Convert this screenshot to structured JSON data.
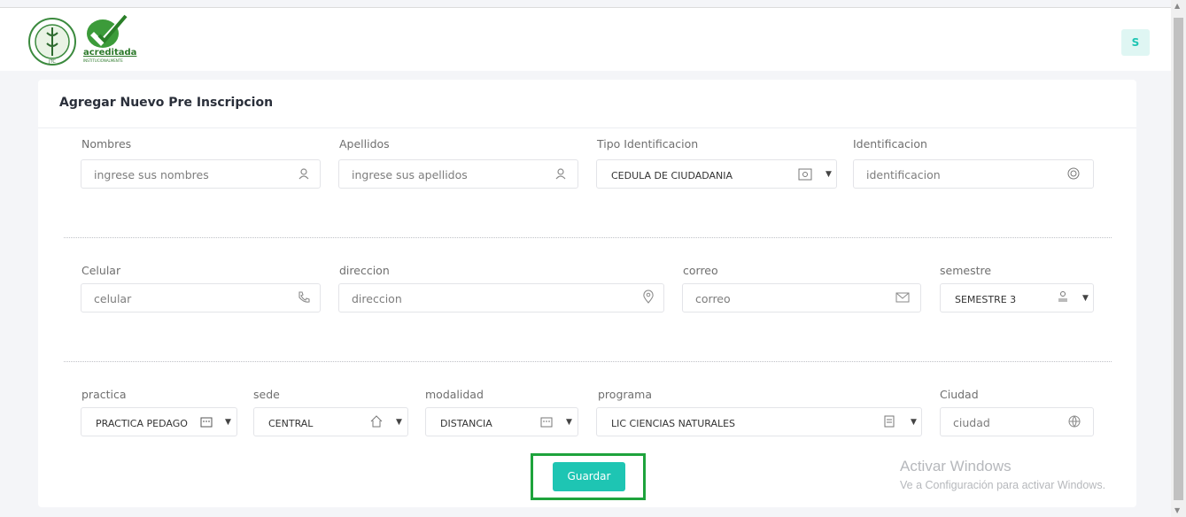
{
  "header": {
    "avatar_letter": "S",
    "logo_text": "acreditada",
    "logo_subtext": "INSTITUCIONALMENTE"
  },
  "form": {
    "title": "Agregar Nuevo Pre Inscripcion",
    "rows": [
      [
        {
          "label": "Nombres",
          "placeholder": "ingrese sus nombres",
          "icon": "user-icon"
        },
        {
          "label": "Apellidos",
          "placeholder": "ingrese sus apellidos",
          "icon": "user-icon"
        },
        {
          "label": "Tipo Identificacion",
          "value": "CEDULA DE CIUDADANIA",
          "icon": "id-card-icon"
        },
        {
          "label": "Identificacion",
          "placeholder": "identificacion",
          "icon": "fingerprint-icon"
        }
      ],
      [
        {
          "label": "Celular",
          "placeholder": "celular",
          "icon": "phone-icon"
        },
        {
          "label": "direccion",
          "placeholder": "direccion",
          "icon": "location-pin-icon"
        },
        {
          "label": "correo",
          "placeholder": "correo",
          "icon": "envelope-icon"
        },
        {
          "label": "semestre",
          "value": "SEMESTRE 3",
          "icon": "hierarchy-icon"
        }
      ],
      [
        {
          "label": "practica",
          "value": "PRACTICA PEDAGO",
          "icon": "building-icon"
        },
        {
          "label": "sede",
          "value": "CENTRAL",
          "icon": "home-icon"
        },
        {
          "label": "modalidad",
          "value": "DISTANCIA",
          "icon": "building-icon"
        },
        {
          "label": "programa",
          "value": "LIC CIENCIAS NATURALES",
          "icon": "document-icon"
        },
        {
          "label": "Ciudad",
          "placeholder": "ciudad",
          "icon": "globe-icon"
        }
      ]
    ],
    "save_label": "Guardar"
  },
  "watermark": {
    "line1": "Activar Windows",
    "line2": "Ve a Configuración para activar Windows."
  },
  "colors": {
    "accent": "#1ec5b3",
    "highlight": "#1ea33c"
  }
}
